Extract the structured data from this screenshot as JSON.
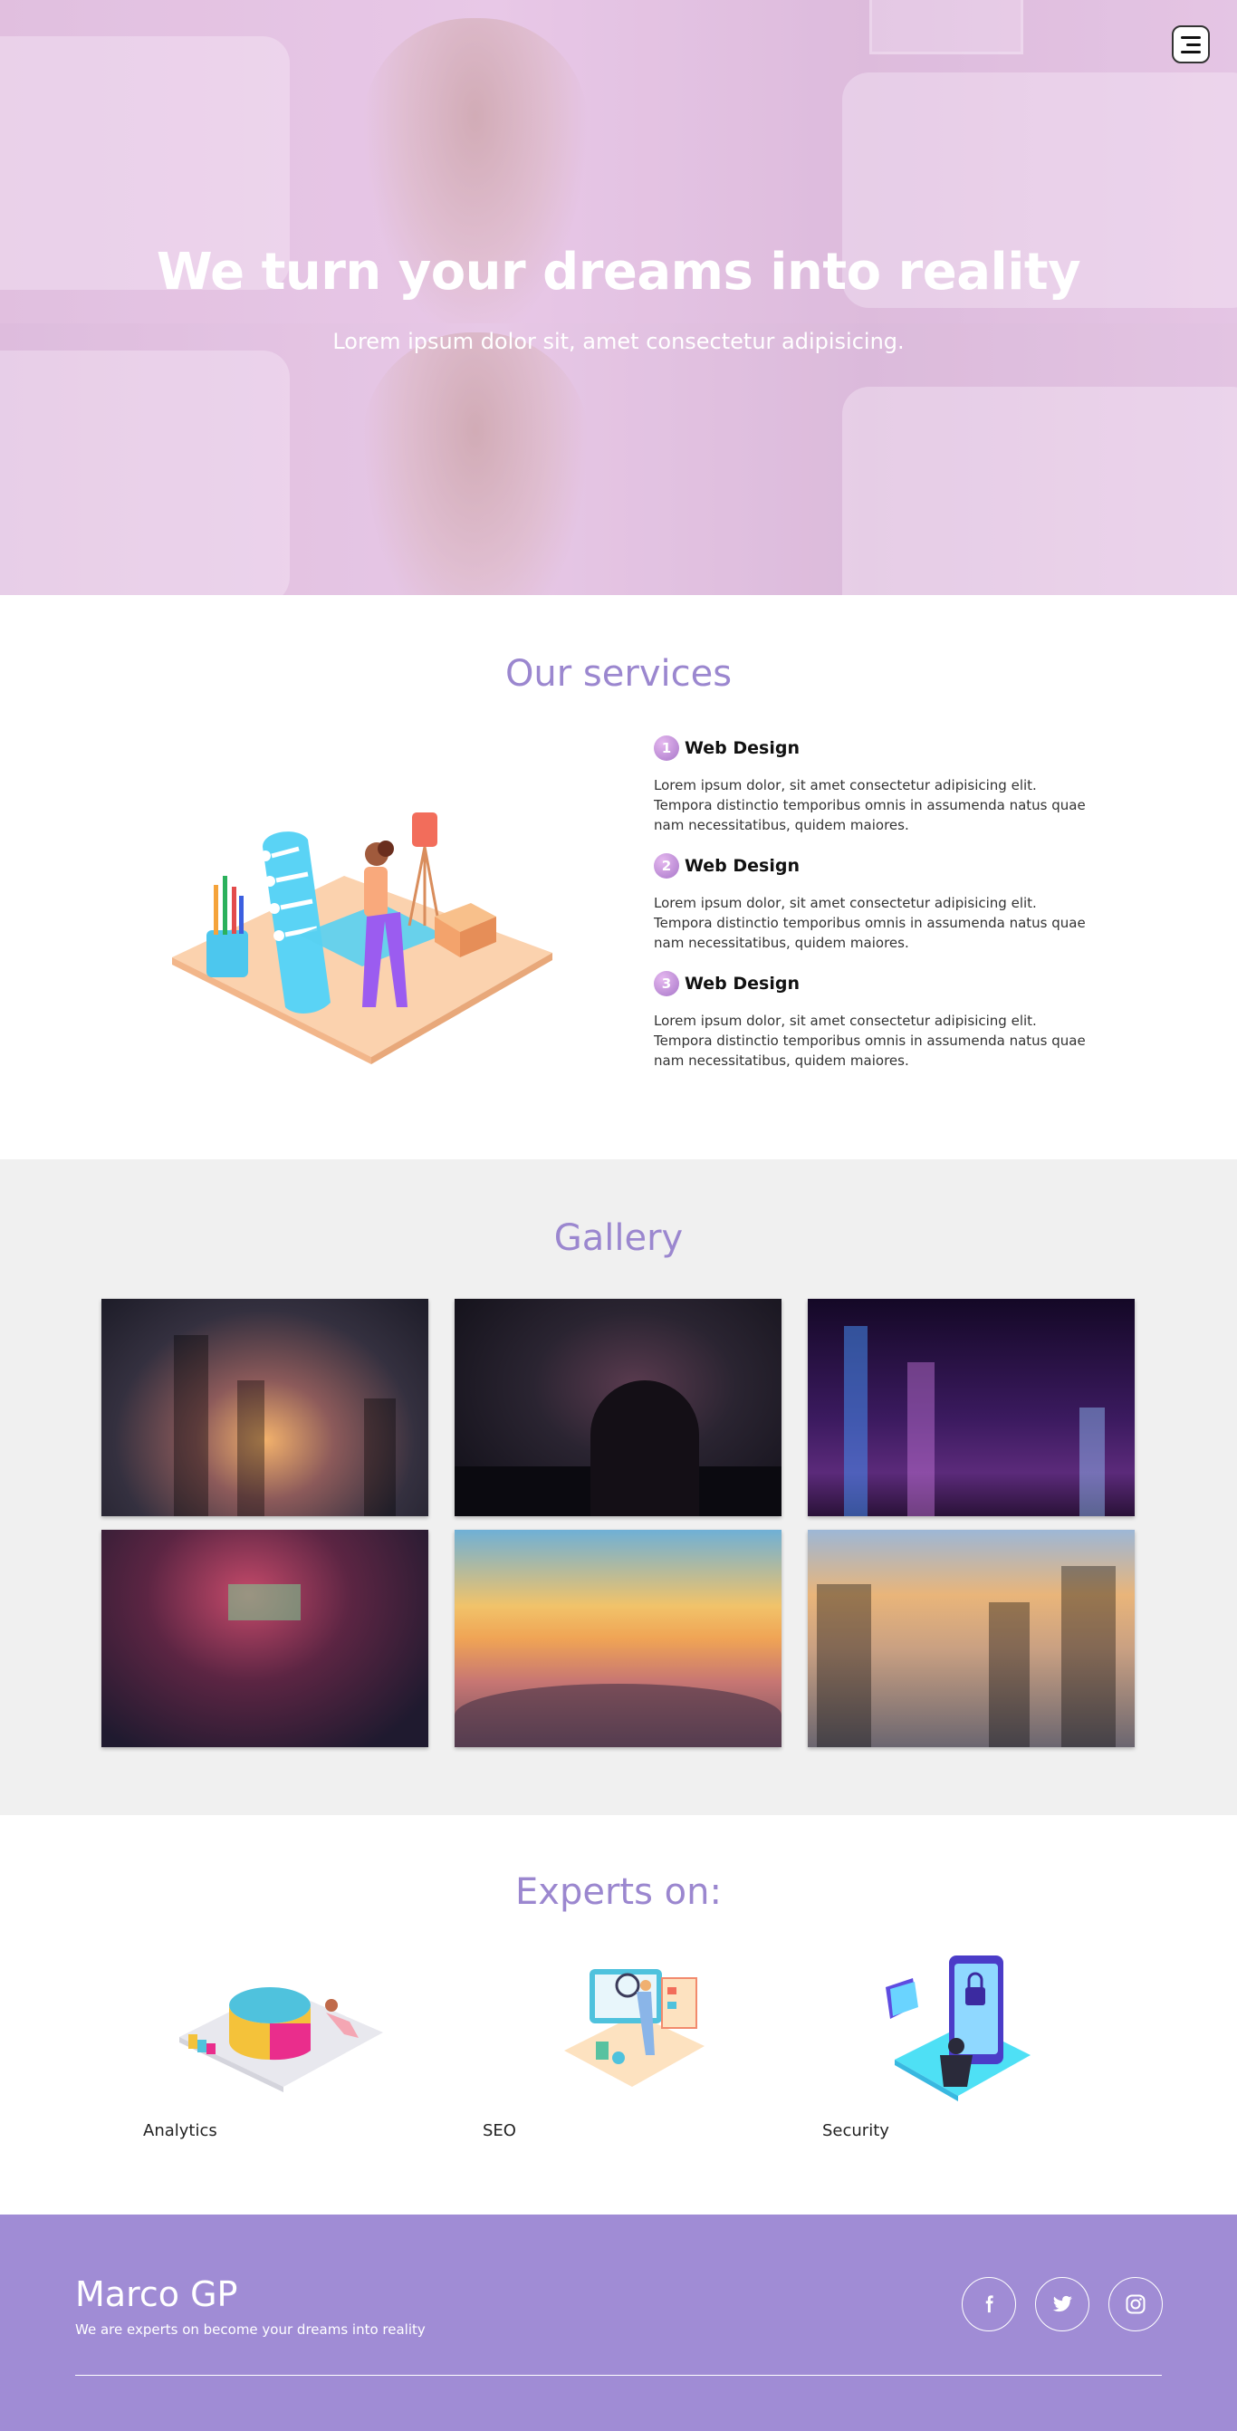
{
  "hero": {
    "title": "We turn your dreams into reality",
    "subtitle": "Lorem ipsum dolor sit, amet consectetur adipisicing.",
    "menu_icon": "hamburger-menu-icon"
  },
  "services": {
    "title": "Our services",
    "items": [
      {
        "number": "1",
        "name": "Web Design",
        "description": "Lorem ipsum dolor, sit amet consectetur adipisicing elit. Tempora distinctio temporibus omnis in assumenda natus quae nam necessitatibus, quidem maiores."
      },
      {
        "number": "2",
        "name": "Web Design",
        "description": "Lorem ipsum dolor, sit amet consectetur adipisicing elit. Tempora distinctio temporibus omnis in assumenda natus quae nam necessitatibus, quidem maiores."
      },
      {
        "number": "3",
        "name": "Web Design",
        "description": "Lorem ipsum dolor, sit amet consectetur adipisicing elit. Tempora distinctio temporibus omnis in assumenda natus quae nam necessitatibus, quidem maiores."
      }
    ]
  },
  "gallery": {
    "title": "Gallery"
  },
  "experts": {
    "title": "Experts on:",
    "items": [
      {
        "label": "Analytics",
        "icon": "analytics-illustration"
      },
      {
        "label": "SEO",
        "icon": "seo-illustration"
      },
      {
        "label": "Security",
        "icon": "security-illustration"
      }
    ]
  },
  "footer": {
    "brand": "Marco GP",
    "tagline": "We are experts on become your dreams into reality",
    "socials": [
      "facebook-icon",
      "twitter-icon",
      "instagram-icon"
    ]
  },
  "colors": {
    "accent": "#9b87cf",
    "footer_bg": "#a08cd5",
    "gallery_bg": "#f0f0f0"
  }
}
